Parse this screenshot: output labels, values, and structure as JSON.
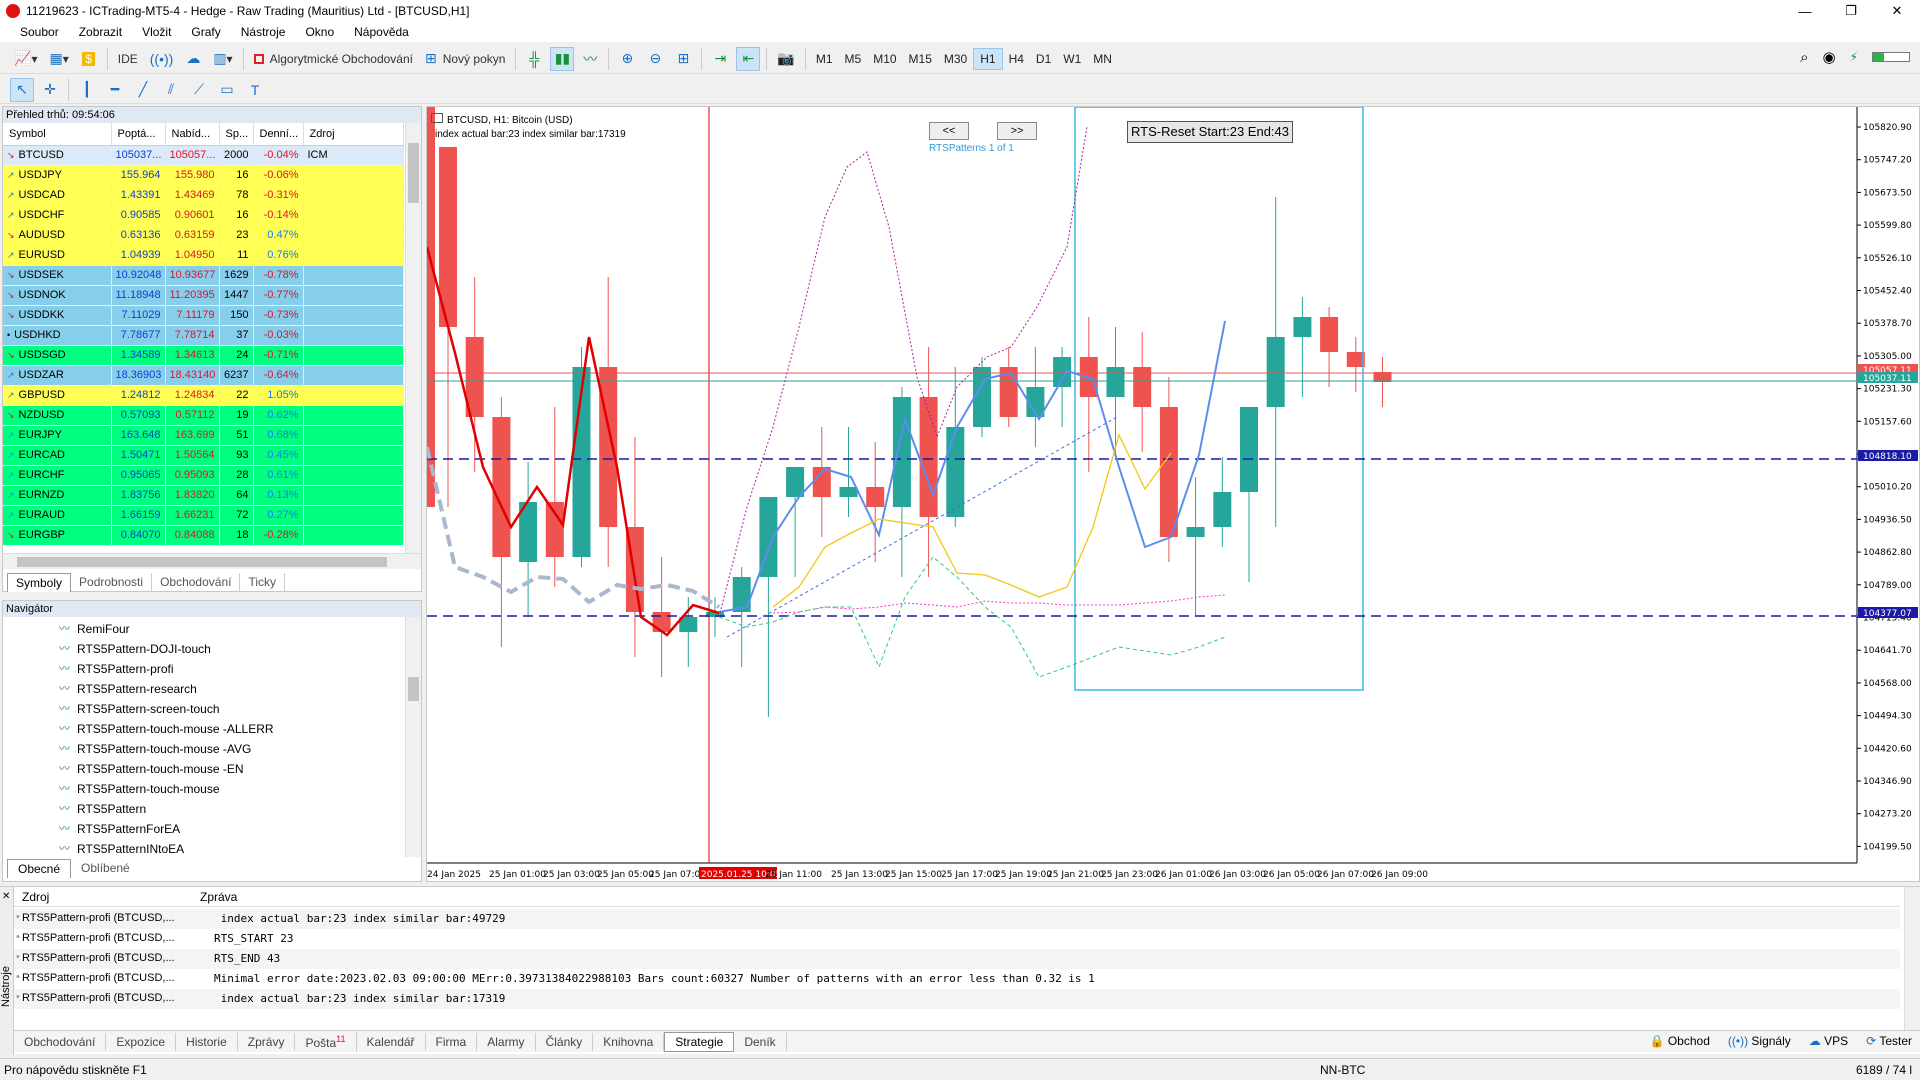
{
  "window": {
    "title": "11219623 - ICTrading-MT5-4 - Hedge - Raw Trading (Mauritius) Ltd - [BTCUSD,H1]",
    "minimize": "—",
    "maximize": "❐",
    "close": "✕"
  },
  "menu": [
    "Soubor",
    "Zobrazit",
    "Vložit",
    "Grafy",
    "Nástroje",
    "Okno",
    "Nápověda"
  ],
  "toolbar": {
    "ide": "IDE",
    "algo_trading": "Algorytmické Obchodování",
    "new_order": "Nový pokyn",
    "timeframes": [
      "M1",
      "M5",
      "M10",
      "M15",
      "M30",
      "H1",
      "H4",
      "D1",
      "W1",
      "MN"
    ],
    "active_timeframe": "H1"
  },
  "market_watch": {
    "header": "Přehled trhů: 09:54:06",
    "columns": [
      "Symbol",
      "Poptá...",
      "Nabíd...",
      "Sp...",
      "Denní...",
      "Zdroj"
    ],
    "rows": [
      {
        "symbol": "BTCUSD",
        "bid": "105037...",
        "ask": "105057...",
        "spread": "2000",
        "daily": "-0.04%",
        "source": "ICM",
        "dir": "down",
        "bg": "#dce9f8"
      },
      {
        "symbol": "USDJPY",
        "bid": "155.964",
        "ask": "155.980",
        "spread": "16",
        "daily": "-0.06%",
        "source": "",
        "dir": "up",
        "bg": "#ffff55"
      },
      {
        "symbol": "USDCAD",
        "bid": "1.43391",
        "ask": "1.43469",
        "spread": "78",
        "daily": "-0.31%",
        "source": "",
        "dir": "up",
        "bg": "#ffff55"
      },
      {
        "symbol": "USDCHF",
        "bid": "0.90585",
        "ask": "0.90601",
        "spread": "16",
        "daily": "-0.14%",
        "source": "",
        "dir": "up",
        "bg": "#ffff55"
      },
      {
        "symbol": "AUDUSD",
        "bid": "0.63136",
        "ask": "0.63159",
        "spread": "23",
        "daily": "0.47%",
        "source": "",
        "dir": "down",
        "bg": "#ffff55"
      },
      {
        "symbol": "EURUSD",
        "bid": "1.04939",
        "ask": "1.04950",
        "spread": "11",
        "daily": "0.76%",
        "source": "",
        "dir": "up",
        "bg": "#ffff55"
      },
      {
        "symbol": "USDSEK",
        "bid": "10.92048",
        "ask": "10.93677",
        "spread": "1629",
        "daily": "-0.78%",
        "source": "",
        "dir": "down",
        "bg": "#87ceeb"
      },
      {
        "symbol": "USDNOK",
        "bid": "11.18948",
        "ask": "11.20395",
        "spread": "1447",
        "daily": "-0.77%",
        "source": "",
        "dir": "down",
        "bg": "#87ceeb"
      },
      {
        "symbol": "USDDKK",
        "bid": "7.11029",
        "ask": "7.11179",
        "spread": "150",
        "daily": "-0.73%",
        "source": "",
        "dir": "down",
        "bg": "#87ceeb"
      },
      {
        "symbol": "USDHKD",
        "bid": "7.78677",
        "ask": "7.78714",
        "spread": "37",
        "daily": "-0.03%",
        "source": "",
        "dir": "none",
        "bg": "#87ceeb"
      },
      {
        "symbol": "USDSGD",
        "bid": "1.34589",
        "ask": "1.34613",
        "spread": "24",
        "daily": "-0.71%",
        "source": "",
        "dir": "down",
        "bg": "#00ff7f"
      },
      {
        "symbol": "USDZAR",
        "bid": "18.36903",
        "ask": "18.43140",
        "spread": "6237",
        "daily": "-0.64%",
        "source": "",
        "dir": "up",
        "bg": "#87ceeb"
      },
      {
        "symbol": "GBPUSD",
        "bid": "1.24812",
        "ask": "1.24834",
        "spread": "22",
        "daily": "1.05%",
        "source": "",
        "dir": "up",
        "bg": "#ffff55"
      },
      {
        "symbol": "NZDUSD",
        "bid": "0.57093",
        "ask": "0.57112",
        "spread": "19",
        "daily": "0.62%",
        "source": "",
        "dir": "down",
        "bg": "#00ff7f"
      },
      {
        "symbol": "EURJPY",
        "bid": "163.648",
        "ask": "163.699",
        "spread": "51",
        "daily": "0.68%",
        "source": "",
        "dir": "up",
        "bg": "#00ff7f"
      },
      {
        "symbol": "EURCAD",
        "bid": "1.50471",
        "ask": "1.50564",
        "spread": "93",
        "daily": "0.45%",
        "source": "",
        "dir": "up",
        "bg": "#00ff7f"
      },
      {
        "symbol": "EURCHF",
        "bid": "0.95065",
        "ask": "0.95093",
        "spread": "28",
        "daily": "0.61%",
        "source": "",
        "dir": "up",
        "bg": "#00ff7f"
      },
      {
        "symbol": "EURNZD",
        "bid": "1.83756",
        "ask": "1.83820",
        "spread": "64",
        "daily": "0.13%",
        "source": "",
        "dir": "up",
        "bg": "#00ff7f"
      },
      {
        "symbol": "EURAUD",
        "bid": "1.66159",
        "ask": "1.66231",
        "spread": "72",
        "daily": "0.27%",
        "source": "",
        "dir": "up",
        "bg": "#00ff7f"
      },
      {
        "symbol": "EURGBP",
        "bid": "0.84070",
        "ask": "0.84088",
        "spread": "18",
        "daily": "-0.28%",
        "source": "",
        "dir": "down",
        "bg": "#00ff7f"
      }
    ],
    "tabs": [
      "Symboly",
      "Podrobnosti",
      "Obchodování",
      "Ticky"
    ]
  },
  "navigator": {
    "header": "Navigátor",
    "items": [
      "RemiFour",
      "RTS5Pattern-DOJI-touch",
      "RTS5Pattern-profi",
      "RTS5Pattern-research",
      "RTS5Pattern-screen-touch",
      "RTS5Pattern-touch-mouse -ALLERR",
      "RTS5Pattern-touch-mouse -AVG",
      "RTS5Pattern-touch-mouse -EN",
      "RTS5Pattern-touch-mouse",
      "RTS5Pattern",
      "RTS5PatternForEA",
      "RTS5PatternINtoEA"
    ],
    "tabs": [
      "Obecné",
      "Oblíbené"
    ]
  },
  "chart": {
    "title": "BTCUSD, H1:  Bitcoin (USD)",
    "subtitle": "index actual bar:23 index similar bar:17319",
    "prev_button": "<<",
    "next_button": ">>",
    "patterns_label": "RTSPatterns 1 of 1",
    "reset_button": "RTS-Reset Start:23 End:43",
    "price_ticks": [
      "105820.90",
      "105747.20",
      "105673.50",
      "105599.80",
      "105526.10",
      "105452.40",
      "105378.70",
      "105305.00",
      "105231.30",
      "105157.60",
      "105083.90",
      "105010.20",
      "104936.50",
      "104862.80",
      "104789.00",
      "104715.40",
      "104641.70",
      "104568.00",
      "104494.30",
      "104420.60",
      "104346.90",
      "104273.20",
      "104199.50"
    ],
    "price_labels": {
      "ask": "105057.11",
      "bid": "105037.11",
      "line1": "104818.10",
      "line2": "104377.07"
    },
    "time_ticks": [
      "24 Jan 2025",
      "25 Jan 01:00",
      "25 Jan 03:00",
      "25 Jan 05:00",
      "25 Jan 07:00",
      "2025.01.25 10:05",
      "25 Jan 11:00",
      "25 Jan 13:00",
      "25 Jan 15:00",
      "25 Jan 17:00",
      "25 Jan 19:00",
      "25 Jan 21:00",
      "25 Jan 23:00",
      "26 Jan 01:00",
      "26 Jan 03:00",
      "26 Jan 05:00",
      "26 Jan 07:00",
      "26 Jan 09:00"
    ],
    "colors": {
      "bull": "#26a69a",
      "bear": "#ef5350",
      "red_line": "#e00000",
      "blue_line": "#5b8def",
      "yellow_line": "#f5c518",
      "magenta": "#b01fa0",
      "pink": "#ff33cc",
      "green_dash": "#2ecc71",
      "cyan_box": "#35b8e8",
      "navy_dash": "#1a1aa6"
    }
  },
  "toolbox": {
    "columns": [
      "Zdroj",
      "Zpráva"
    ],
    "rows": [
      {
        "source": "RTS5Pattern-profi (BTCUSD,...",
        "message": " index actual bar:23 index similar bar:49729"
      },
      {
        "source": "RTS5Pattern-profi (BTCUSD,...",
        "message": "RTS_START 23"
      },
      {
        "source": "RTS5Pattern-profi (BTCUSD,...",
        "message": "RTS_END 43"
      },
      {
        "source": "RTS5Pattern-profi (BTCUSD,...",
        "message": "Minimal error date:2023.02.03 09:00:00 MErr:0.39731384022988103 Bars count:60327 Number of patterns with an error less than 0.32 is 1"
      },
      {
        "source": "RTS5Pattern-profi (BTCUSD,...",
        "message": " index actual bar:23 index similar bar:17319"
      }
    ],
    "side_label": "Nástroje",
    "tabs": [
      "Obchodování",
      "Expozice",
      "Historie",
      "Zprávy",
      "Pošta",
      "Kalendář",
      "Firma",
      "Alarmy",
      "Články",
      "Knihovna",
      "Strategie",
      "Deník"
    ],
    "mail_badge": "11",
    "active_tab": "Strategie",
    "right": [
      "Obchod",
      "Signály",
      "VPS",
      "Tester"
    ]
  },
  "status": {
    "help": "Pro nápovědu stiskněte F1",
    "profile": "NN-BTC",
    "traffic": "6189 / 74 l"
  }
}
